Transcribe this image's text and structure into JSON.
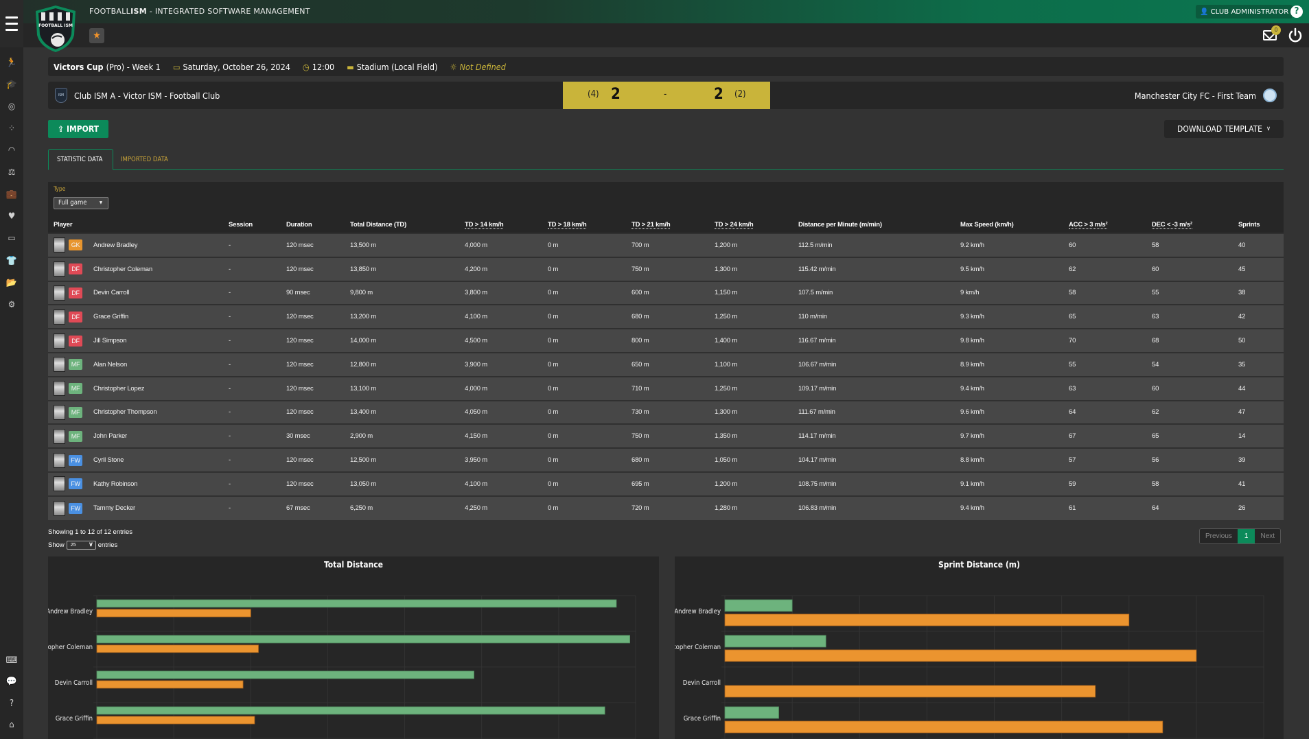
{
  "app": {
    "title_prefix": "FOOTBALL",
    "title_bold": "ISM",
    "title_suffix": " - INTEGRATED SOFTWARE MANAGEMENT",
    "logo_text": "FOOTBALL ISM",
    "user_role": "CLUB ADMINISTRATOR",
    "help_label": "?",
    "mail_count": "0"
  },
  "sidebar": {
    "items": [
      {
        "icon": "running-icon",
        "glyph": "🏃"
      },
      {
        "icon": "graduation-cap-icon",
        "glyph": "🎓"
      },
      {
        "icon": "target-icon",
        "glyph": "◎"
      },
      {
        "icon": "tactics-icon",
        "glyph": "⁘"
      },
      {
        "icon": "gauge-icon",
        "glyph": "◠"
      },
      {
        "icon": "balance-scale-icon",
        "glyph": "⚖"
      },
      {
        "icon": "briefcase-icon",
        "glyph": "💼"
      },
      {
        "icon": "heartbeat-icon",
        "glyph": "♥"
      },
      {
        "icon": "field-icon",
        "glyph": "▭"
      },
      {
        "icon": "shirt-icon",
        "glyph": "👕"
      },
      {
        "icon": "folder-icon",
        "glyph": "📂"
      },
      {
        "icon": "cogs-icon",
        "glyph": "⚙"
      }
    ],
    "bottom_items": [
      {
        "icon": "code-window-icon",
        "glyph": "⌨"
      },
      {
        "icon": "chat-question-icon",
        "glyph": "💬"
      },
      {
        "icon": "help-circle-icon",
        "glyph": "?"
      },
      {
        "icon": "home-icon",
        "glyph": "⌂"
      }
    ]
  },
  "match": {
    "competition": "Victors Cup",
    "level": " (Pro) - Week 1",
    "date": "Saturday, October 26, 2024",
    "time": "12:00",
    "venue": "Stadium (Local Field)",
    "weather": "Not Defined",
    "home_team": "Club ISM A - Victor ISM - Football Club",
    "home_badge": "ISM",
    "away_team": "Manchester City FC - First Team",
    "home_penalties": "(4)",
    "home_score": "2",
    "separator": "-",
    "away_score": "2",
    "away_penalties": "(2)",
    "score_color": "#c9b43a"
  },
  "actions": {
    "import_label": "IMPORT",
    "download_label": "DOWNLOAD TEMPLATE"
  },
  "tabs": [
    {
      "label": "STATISTIC DATA",
      "active": true
    },
    {
      "label": "IMPORTED DATA",
      "active": false
    }
  ],
  "filter": {
    "type_label": "Type",
    "type_value": "Full game"
  },
  "table": {
    "columns": [
      "Player",
      "Session",
      "Duration",
      "Total Distance (TD)",
      "TD > 14 km/h",
      "TD > 18 km/h",
      "TD > 21 km/h",
      "TD > 24 km/h",
      "Distance per Minute (m/min)",
      "Max Speed (km/h)",
      "ACC > 3 m/s²",
      "DEC < -3 m/s²",
      "Sprints"
    ],
    "rows": [
      {
        "name": "Andrew Bradley",
        "pos": "GK",
        "session": "-",
        "duration": "120 msec",
        "td": "13,500 m",
        "td14": "4,000 m",
        "td18": "0 m",
        "td21": "700 m",
        "td24": "1,200 m",
        "dpm": "112.5 m/min",
        "max_speed": "9.2 km/h",
        "acc": "60",
        "dec": "58",
        "sprints": "40"
      },
      {
        "name": "Christopher Coleman",
        "pos": "DF",
        "session": "-",
        "duration": "120 msec",
        "td": "13,850 m",
        "td14": "4,200 m",
        "td18": "0 m",
        "td21": "750 m",
        "td24": "1,300 m",
        "dpm": "115.42 m/min",
        "max_speed": "9.5 km/h",
        "acc": "62",
        "dec": "60",
        "sprints": "45"
      },
      {
        "name": "Devin Carroll",
        "pos": "DF",
        "session": "-",
        "duration": "90 msec",
        "td": "9,800 m",
        "td14": "3,800 m",
        "td18": "0 m",
        "td21": "600 m",
        "td24": "1,150 m",
        "dpm": "107.5 m/min",
        "max_speed": "9 km/h",
        "acc": "58",
        "dec": "55",
        "sprints": "38"
      },
      {
        "name": "Grace Griffin",
        "pos": "DF",
        "session": "-",
        "duration": "120 msec",
        "td": "13,200 m",
        "td14": "4,100 m",
        "td18": "0 m",
        "td21": "680 m",
        "td24": "1,250 m",
        "dpm": "110 m/min",
        "max_speed": "9.3 km/h",
        "acc": "65",
        "dec": "63",
        "sprints": "42"
      },
      {
        "name": "Jill Simpson",
        "pos": "DF",
        "session": "-",
        "duration": "120 msec",
        "td": "14,000 m",
        "td14": "4,500 m",
        "td18": "0 m",
        "td21": "800 m",
        "td24": "1,400 m",
        "dpm": "116.67 m/min",
        "max_speed": "9.8 km/h",
        "acc": "70",
        "dec": "68",
        "sprints": "50"
      },
      {
        "name": "Alan Nelson",
        "pos": "MF",
        "session": "-",
        "duration": "120 msec",
        "td": "12,800 m",
        "td14": "3,900 m",
        "td18": "0 m",
        "td21": "650 m",
        "td24": "1,100 m",
        "dpm": "106.67 m/min",
        "max_speed": "8.9 km/h",
        "acc": "55",
        "dec": "54",
        "sprints": "35"
      },
      {
        "name": "Christopher Lopez",
        "pos": "MF",
        "session": "-",
        "duration": "120 msec",
        "td": "13,100 m",
        "td14": "4,000 m",
        "td18": "0 m",
        "td21": "710 m",
        "td24": "1,250 m",
        "dpm": "109.17 m/min",
        "max_speed": "9.4 km/h",
        "acc": "63",
        "dec": "60",
        "sprints": "44"
      },
      {
        "name": "Christopher Thompson",
        "pos": "MF",
        "session": "-",
        "duration": "120 msec",
        "td": "13,400 m",
        "td14": "4,050 m",
        "td18": "0 m",
        "td21": "730 m",
        "td24": "1,300 m",
        "dpm": "111.67 m/min",
        "max_speed": "9.6 km/h",
        "acc": "64",
        "dec": "62",
        "sprints": "47"
      },
      {
        "name": "John Parker",
        "pos": "MF",
        "session": "-",
        "duration": "30 msec",
        "td": "2,900 m",
        "td14": "4,150 m",
        "td18": "0 m",
        "td21": "750 m",
        "td24": "1,350 m",
        "dpm": "114.17 m/min",
        "max_speed": "9.7 km/h",
        "acc": "67",
        "dec": "65",
        "sprints": "14"
      },
      {
        "name": "Cyril Stone",
        "pos": "FW",
        "session": "-",
        "duration": "120 msec",
        "td": "12,500 m",
        "td14": "3,950 m",
        "td18": "0 m",
        "td21": "680 m",
        "td24": "1,050 m",
        "dpm": "104.17 m/min",
        "max_speed": "8.8 km/h",
        "acc": "57",
        "dec": "56",
        "sprints": "39"
      },
      {
        "name": "Kathy Robinson",
        "pos": "FW",
        "session": "-",
        "duration": "120 msec",
        "td": "13,050 m",
        "td14": "4,100 m",
        "td18": "0 m",
        "td21": "695 m",
        "td24": "1,200 m",
        "dpm": "108.75 m/min",
        "max_speed": "9.1 km/h",
        "acc": "59",
        "dec": "58",
        "sprints": "41"
      },
      {
        "name": "Tammy Decker",
        "pos": "FW",
        "session": "-",
        "duration": "67 msec",
        "td": "6,250 m",
        "td14": "4,250 m",
        "td18": "0 m",
        "td21": "720 m",
        "td24": "1,280 m",
        "dpm": "106.83 m/min",
        "max_speed": "9.4 km/h",
        "acc": "61",
        "dec": "64",
        "sprints": "26"
      }
    ],
    "position_colors": {
      "GK": "#e8952e",
      "DF": "#e04a56",
      "MF": "#6db37d",
      "FW": "#4a90e2"
    }
  },
  "footer": {
    "showing": "Showing 1 to 12 of 12 entries",
    "show_label": "Show",
    "page_length": "25",
    "entries_label": "entries",
    "previous": "Previous",
    "current_page": "1",
    "next": "Next"
  },
  "chart_data": [
    {
      "type": "bar",
      "orientation": "horizontal",
      "title": "Total Distance",
      "categories": [
        "Andrew Bradley",
        "Christopher Coleman",
        "Devin Carroll",
        "Grace Griffin"
      ],
      "series": [
        {
          "name": "Total Distance (TD)",
          "color": "#6db37d",
          "values": [
            13500,
            13850,
            9800,
            13200
          ]
        },
        {
          "name": "TD > 14 km/h",
          "color": "#eb942f",
          "values": [
            4000,
            4200,
            3800,
            4100
          ]
        }
      ],
      "xlim": [
        0,
        14000
      ],
      "x_step": 2000,
      "grid": true
    },
    {
      "type": "bar",
      "orientation": "horizontal",
      "title": "Sprint Distance (m)",
      "categories": [
        "Andrew Bradley",
        "Christopher Coleman",
        "Devin Carroll",
        "Grace Griffin"
      ],
      "series": [
        {
          "name": "TD > 21 km/h",
          "color": "#6db37d",
          "values": [
            700,
            750,
            600,
            680
          ]
        },
        {
          "name": "TD > 24 km/h",
          "color": "#eb942f",
          "values": [
            1200,
            1300,
            1150,
            1250
          ]
        }
      ],
      "xlim": [
        600,
        1400
      ],
      "x_step": 100,
      "grid": true
    }
  ]
}
